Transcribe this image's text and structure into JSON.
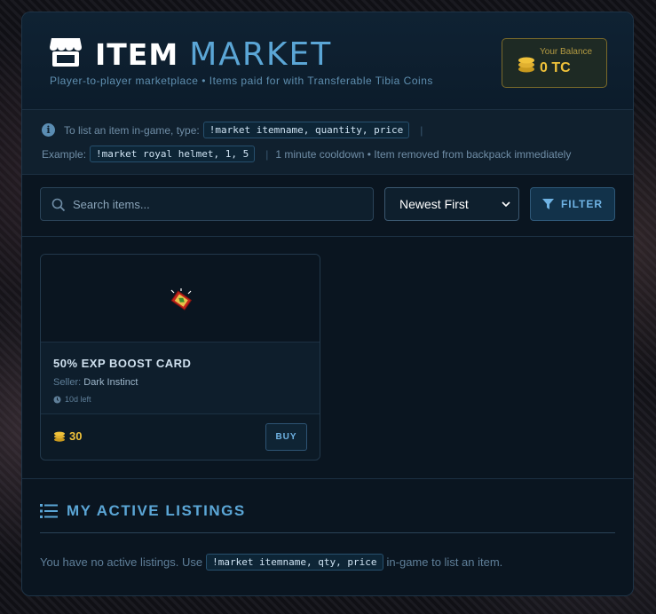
{
  "header": {
    "title_part1": "ITEM",
    "title_part2": "MARKET",
    "subtitle": "Player-to-player marketplace • Items paid for with Transferable Tibia Coins",
    "balance_label": "Your Balance",
    "balance_value": "0 TC"
  },
  "info": {
    "line1_prefix": "To list an item in-game, type:",
    "line1_code": "!market itemname, quantity, price",
    "line1_sep": "|",
    "line2_prefix": "Example:",
    "line2_code": "!market royal helmet, 1, 5",
    "line2_sep": "|",
    "line2_note": "1 minute cooldown • Item removed from backpack immediately"
  },
  "controls": {
    "search_placeholder": "Search items...",
    "sort_selected": "Newest First",
    "filter_label": "FILTER"
  },
  "items": [
    {
      "name": "50% EXP BOOST CARD",
      "seller_label": "Seller:",
      "seller": "Dark Instinct",
      "time_left": "10d left",
      "price": "30",
      "buy_label": "BUY"
    }
  ],
  "listings": {
    "title": "MY ACTIVE LISTINGS",
    "empty_prefix": "You have no active listings. Use",
    "empty_code": "!market itemname, qty, price",
    "empty_suffix": "in-game to list an item."
  },
  "colors": {
    "accent": "#5ba6d6",
    "gold": "#f0c23a",
    "panel": "#0a1520"
  },
  "icons": [
    "store-icon",
    "coins-icon",
    "info-icon",
    "search-icon",
    "chevron-down-icon",
    "filter-icon",
    "clock-icon",
    "list-icon",
    "card-item-icon"
  ]
}
